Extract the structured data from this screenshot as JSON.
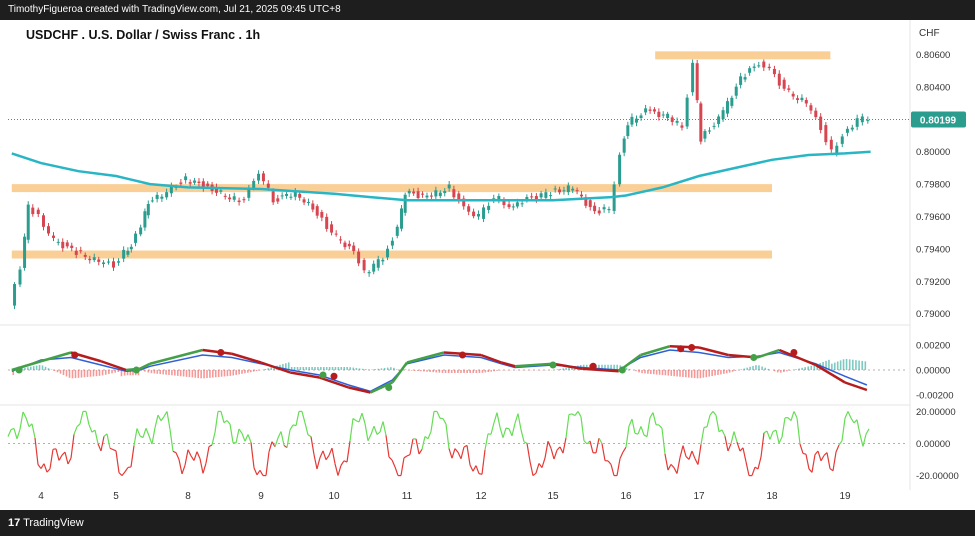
{
  "header": {
    "credit": "TimothyFigueroa created with TradingView.com, Jul 21, 2025 09:45 UTC+8"
  },
  "footer": {
    "brand": "TradingView"
  },
  "chart_data": [
    {
      "type": "candlestick",
      "title": "USDCHF . U.S. Dollar / Swiss Franc . 1h",
      "currency_label": "CHF",
      "y_ticks": [
        "0.80600",
        "0.80400",
        "0.80200",
        "0.80000",
        "0.79800",
        "0.79600",
        "0.79400",
        "0.79200",
        "0.79000"
      ],
      "ylim": [
        0.7893,
        0.8069
      ],
      "x_ticks": [
        "4",
        "5",
        "8",
        "9",
        "10",
        "11",
        "12",
        "15",
        "16",
        "17",
        "18",
        "19"
      ],
      "last_price_label": "0.80199",
      "last_price": 0.80199,
      "moving_average_color": "#29b6c4",
      "up_color": "#2a9d8f",
      "down_color": "#d64550",
      "zone_color": "#f9c784",
      "zones": [
        {
          "from_day": 16.4,
          "to_day": 18.8,
          "low": 0.8058,
          "high": 0.8062
        },
        {
          "from_day": 3.6,
          "to_day": 18.0,
          "low": 0.7976,
          "high": 0.798
        },
        {
          "from_day": 3.6,
          "to_day": 18.0,
          "low": 0.7935,
          "high": 0.7939
        }
      ],
      "price_path": [
        [
          3.6,
          0.7905
        ],
        [
          3.75,
          0.7928
        ],
        [
          3.85,
          0.7966
        ],
        [
          4.0,
          0.796
        ],
        [
          4.2,
          0.7945
        ],
        [
          4.5,
          0.7938
        ],
        [
          4.8,
          0.7932
        ],
        [
          5.0,
          0.793
        ],
        [
          5.3,
          0.7938
        ],
        [
          5.5,
          0.7942
        ],
        [
          5.8,
          0.7955
        ],
        [
          6.0,
          0.7968
        ],
        [
          8.0,
          0.7983
        ],
        [
          8.3,
          0.7978
        ],
        [
          8.6,
          0.7972
        ],
        [
          8.8,
          0.797
        ],
        [
          9.0,
          0.7988
        ],
        [
          9.2,
          0.797
        ],
        [
          9.5,
          0.7975
        ],
        [
          9.8,
          0.7962
        ],
        [
          10.0,
          0.795
        ],
        [
          10.3,
          0.7938
        ],
        [
          10.45,
          0.7925
        ],
        [
          10.7,
          0.7935
        ],
        [
          10.9,
          0.7952
        ],
        [
          11.0,
          0.7975
        ],
        [
          11.3,
          0.7972
        ],
        [
          11.6,
          0.7978
        ],
        [
          11.8,
          0.7965
        ],
        [
          12.0,
          0.796
        ],
        [
          12.3,
          0.7968
        ],
        [
          12.6,
          0.7972
        ],
        [
          12.9,
          0.7964
        ],
        [
          13.0,
          0.7968
        ],
        [
          15.0,
          0.7975
        ],
        [
          15.3,
          0.7978
        ],
        [
          15.6,
          0.7962
        ],
        [
          15.8,
          0.7965
        ],
        [
          15.95,
          0.7998
        ],
        [
          16.05,
          0.8018
        ],
        [
          16.3,
          0.8025
        ],
        [
          16.6,
          0.8022
        ],
        [
          16.8,
          0.8015
        ],
        [
          16.95,
          0.8055
        ],
        [
          17.05,
          0.8008
        ],
        [
          17.3,
          0.802
        ],
        [
          17.6,
          0.8045
        ],
        [
          17.85,
          0.8055
        ],
        [
          18.0,
          0.8052
        ],
        [
          18.2,
          0.8038
        ],
        [
          18.5,
          0.803
        ],
        [
          18.7,
          0.8015
        ],
        [
          18.85,
          0.8
        ],
        [
          19.0,
          0.801
        ],
        [
          19.2,
          0.802
        ],
        [
          19.35,
          0.802
        ]
      ],
      "moving_average_path": [
        [
          3.6,
          0.7999
        ],
        [
          4.0,
          0.7993
        ],
        [
          4.5,
          0.7988
        ],
        [
          5.0,
          0.7985
        ],
        [
          6.0,
          0.798
        ],
        [
          8.0,
          0.7978
        ],
        [
          9.0,
          0.7977
        ],
        [
          10.0,
          0.7974
        ],
        [
          10.5,
          0.7972
        ],
        [
          11.0,
          0.797
        ],
        [
          12.0,
          0.797
        ],
        [
          13.0,
          0.797
        ],
        [
          15.0,
          0.797
        ],
        [
          15.8,
          0.7972
        ],
        [
          16.0,
          0.7973
        ],
        [
          16.5,
          0.7978
        ],
        [
          17.0,
          0.7985
        ],
        [
          17.5,
          0.799
        ],
        [
          18.0,
          0.7995
        ],
        [
          18.5,
          0.7998
        ],
        [
          19.0,
          0.7999
        ],
        [
          19.35,
          0.8
        ]
      ]
    },
    {
      "type": "line",
      "indicator": "MACD",
      "y_ticks": [
        "0.00200",
        "0.00000",
        "-0.00200"
      ],
      "ylim": [
        -0.0028,
        0.0028
      ],
      "macd_color": "#2f5fd8",
      "signal_up_color": "#43a047",
      "signal_down_color": "#b71c1c",
      "macd_path": [
        [
          3.6,
          -0.0001
        ],
        [
          4.0,
          0.0008
        ],
        [
          4.4,
          0.001
        ],
        [
          4.8,
          0.0004
        ],
        [
          5.3,
          -0.0001
        ],
        [
          5.7,
          0.0
        ],
        [
          6.0,
          0.0003
        ],
        [
          8.2,
          0.0012
        ],
        [
          8.6,
          0.001
        ],
        [
          9.0,
          0.0005
        ],
        [
          9.4,
          0.0
        ],
        [
          9.8,
          -0.0004
        ],
        [
          10.2,
          -0.0012
        ],
        [
          10.5,
          -0.0017
        ],
        [
          10.8,
          -0.0008
        ],
        [
          11.0,
          0.0005
        ],
        [
          11.5,
          0.0012
        ],
        [
          12.0,
          0.001
        ],
        [
          12.6,
          0.0005
        ],
        [
          13.0,
          0.0002
        ],
        [
          15.0,
          0.0004
        ],
        [
          15.4,
          0.0002
        ],
        [
          15.9,
          0.0
        ],
        [
          16.2,
          0.001
        ],
        [
          16.6,
          0.0016
        ],
        [
          17.0,
          0.0014
        ],
        [
          17.4,
          0.001
        ],
        [
          17.8,
          0.0011
        ],
        [
          18.1,
          0.0014
        ],
        [
          18.6,
          0.0005
        ],
        [
          19.0,
          -0.0005
        ],
        [
          19.3,
          -0.0012
        ]
      ],
      "signal_path": [
        [
          3.6,
          0.0
        ],
        [
          4.0,
          0.0007
        ],
        [
          4.4,
          0.0014
        ],
        [
          4.8,
          0.0007
        ],
        [
          5.3,
          0.0
        ],
        [
          5.7,
          0.0001
        ],
        [
          6.0,
          0.0005
        ],
        [
          8.2,
          0.0016
        ],
        [
          8.6,
          0.0013
        ],
        [
          9.0,
          0.0006
        ],
        [
          9.4,
          -0.0002
        ],
        [
          9.8,
          -0.0006
        ],
        [
          10.2,
          -0.0014
        ],
        [
          10.5,
          -0.0018
        ],
        [
          10.8,
          -0.001
        ],
        [
          11.0,
          0.0006
        ],
        [
          11.5,
          0.0014
        ],
        [
          12.0,
          0.0012
        ],
        [
          12.6,
          0.0006
        ],
        [
          13.0,
          0.0003
        ],
        [
          15.0,
          0.0005
        ],
        [
          15.4,
          0.0001
        ],
        [
          15.9,
          -0.0001
        ],
        [
          16.2,
          0.0012
        ],
        [
          16.6,
          0.0019
        ],
        [
          17.0,
          0.0018
        ],
        [
          17.4,
          0.0012
        ],
        [
          17.8,
          0.001
        ],
        [
          18.1,
          0.0016
        ],
        [
          18.6,
          0.0004
        ],
        [
          19.0,
          -0.001
        ],
        [
          19.3,
          -0.0016
        ]
      ],
      "cross_points": [
        {
          "day": 3.7,
          "value": 0.0,
          "kind": "up"
        },
        {
          "day": 4.45,
          "value": 0.0012,
          "kind": "down"
        },
        {
          "day": 5.6,
          "value": 0.0,
          "kind": "up"
        },
        {
          "day": 8.45,
          "value": 0.0014,
          "kind": "down"
        },
        {
          "day": 9.85,
          "value": -0.0004,
          "kind": "up"
        },
        {
          "day": 10.0,
          "value": -0.0005,
          "kind": "down"
        },
        {
          "day": 10.75,
          "value": -0.0014,
          "kind": "up"
        },
        {
          "day": 11.75,
          "value": 0.0012,
          "kind": "down"
        },
        {
          "day": 15.0,
          "value": 0.0004,
          "kind": "up"
        },
        {
          "day": 15.55,
          "value": 0.0003,
          "kind": "down"
        },
        {
          "day": 15.95,
          "value": 0.0,
          "kind": "up"
        },
        {
          "day": 16.75,
          "value": 0.0017,
          "kind": "down"
        },
        {
          "day": 16.9,
          "value": 0.0018,
          "kind": "down"
        },
        {
          "day": 17.75,
          "value": 0.001,
          "kind": "up"
        },
        {
          "day": 18.3,
          "value": 0.0014,
          "kind": "down"
        }
      ]
    },
    {
      "type": "line",
      "indicator": "Oscillator",
      "y_ticks": [
        "20.00000",
        "0.00000",
        "-20.00000"
      ],
      "ylim": [
        -24,
        24
      ],
      "above_color": "#66dd55",
      "below_color": "#e53935",
      "values_per_day": "sampled oscillation between -20 and 20"
    }
  ]
}
